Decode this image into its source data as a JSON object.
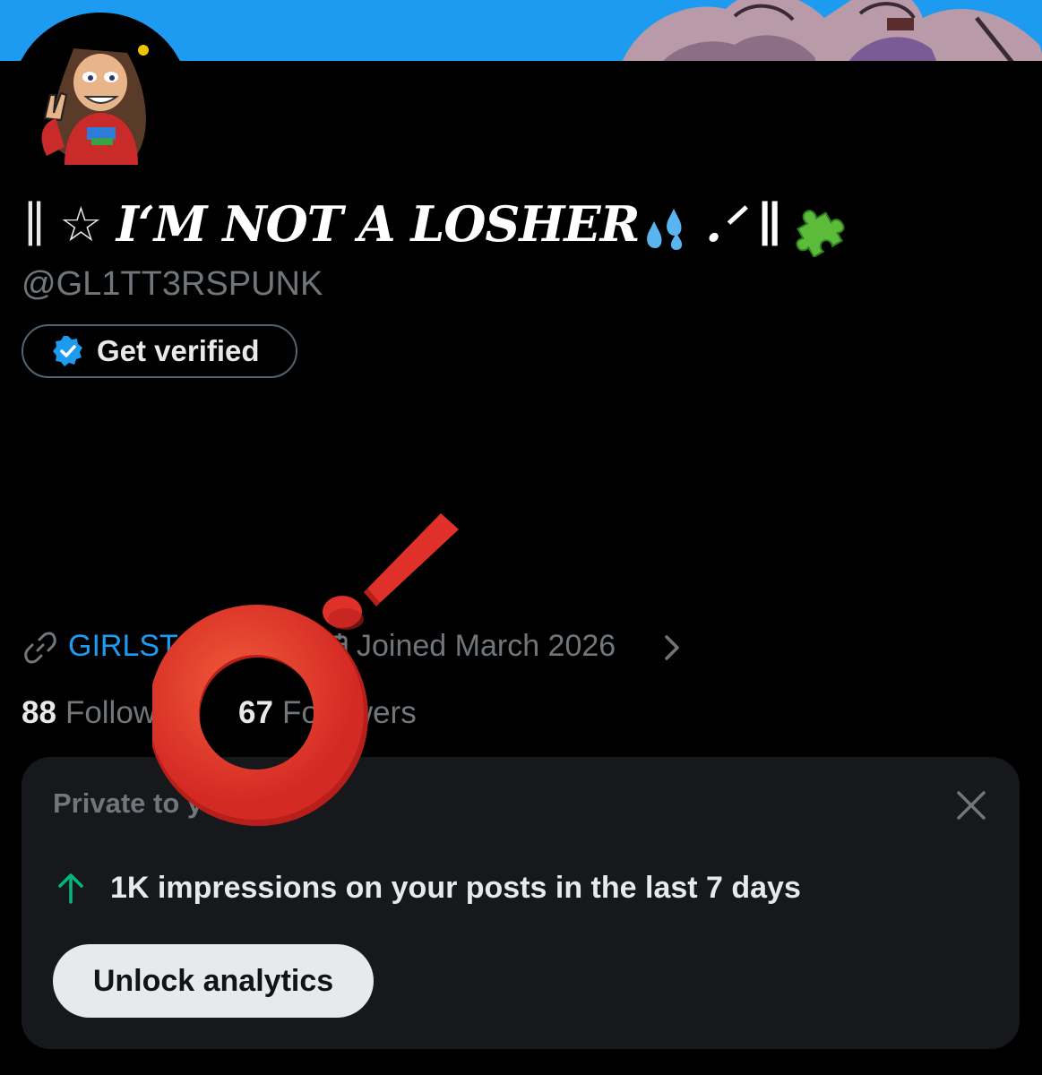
{
  "profile": {
    "display_name_pre": "∥ ☆ ",
    "display_name_main": "I‘M NOT A LOSHER",
    "display_name_post": " .ᐟ ∥",
    "handle": "@GL1TT3RSPUNK",
    "verify_label": "Get verified",
    "website": "GIRLST",
    "joined": "Joined March 2026",
    "following_count": "88",
    "following_label": "Following",
    "followers_count": "67",
    "followers_label": "Followers"
  },
  "private_card": {
    "title": "Private to you",
    "impressions_text": "1K impressions on your posts in the last 7 days",
    "unlock_label": "Unlock analytics"
  },
  "colors": {
    "accent": "#1d9bf0",
    "background": "#000000",
    "card": "#16181c",
    "muted": "#71767b",
    "sticker_red": "#e0302a",
    "arrow_green": "#00ba7c"
  },
  "icons": {
    "link": "link-icon",
    "calendar": "calendar-icon",
    "chevron": "chevron-right-icon",
    "verified": "verified-badge-icon",
    "close": "close-icon",
    "arrow": "arrow-up-icon"
  }
}
